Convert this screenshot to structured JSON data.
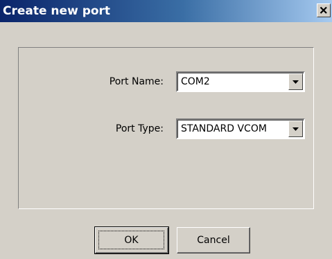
{
  "window": {
    "title": "Create new port"
  },
  "form": {
    "port_name": {
      "label": "Port Name:",
      "value": "COM2"
    },
    "port_type": {
      "label": "Port Type:",
      "value": "STANDARD VCOM"
    }
  },
  "buttons": {
    "ok_label": "OK",
    "cancel_label": "Cancel"
  },
  "icons": {
    "close": "close-icon",
    "dropdown": "chevron-down-icon"
  },
  "colors": {
    "titlebar_start": "#0a246a",
    "titlebar_end": "#a6caf0",
    "face": "#d4d0c8"
  }
}
